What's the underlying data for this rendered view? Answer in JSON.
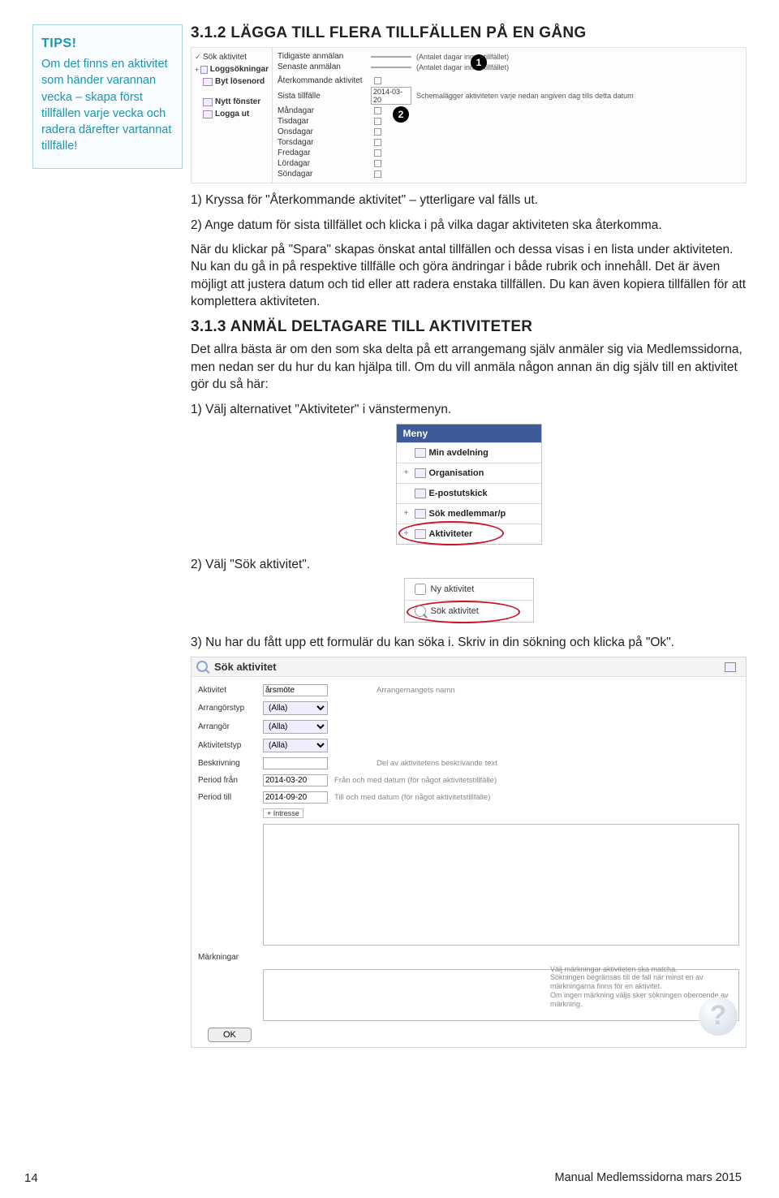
{
  "tip": {
    "title": "TIPS!",
    "text": "Om det finns en aktivitet som händer varannan vecka – skapa först tillfällen varje vecka och radera därefter vartannat tillfälle!"
  },
  "sect312": {
    "heading": "3.1.2 LÄGGA TILL FLERA TILLFÄLLEN PÅ EN GÅNG",
    "step1": "1) Kryssa för \"Återkommande aktivitet\" – ytterligare val fälls ut.",
    "step2": "2) Ange datum för sista tillfället och klicka i på vilka dagar aktiviteten ska återkomma.",
    "para": "När du klickar på \"Spara\" skapas önskat antal tillfällen och dessa visas i en lista under aktiviteten. Nu kan du gå in på respektive tillfälle och göra ändringar i både rubrik och innehåll. Det är även möjligt att justera datum och tid eller att radera enstaka tillfällen. Du kan även kopiera tillfällen för att komplettera aktiviteten."
  },
  "ss1": {
    "left": {
      "sok": "Sök aktivitet",
      "logg": "Loggsökningar",
      "byt": "Byt lösenord",
      "nytt": "Nytt fönster",
      "logga": "Logga ut"
    },
    "right": {
      "tidig": "Tidigaste anmälan",
      "senast": "Senaste anmälan",
      "aterk": "Återkommande aktivitet",
      "sista": "Sista tillfälle",
      "man": "Måndagar",
      "tis": "Tisdagar",
      "ons": "Onsdagar",
      "tor": "Torsdagar",
      "fre": "Fredagar",
      "lor": "Lördagar",
      "son": "Söndagar",
      "sistaVal": "2014-03-20",
      "note1": "(Antalet dagar innan tillfället)",
      "note2": "(Antalet dagar innan tillfället)",
      "note3": "Schemalägger aktiviteten varje nedan angiven dag tills detta datum"
    },
    "badge1": "1",
    "badge2": "2"
  },
  "sect313": {
    "heading": "3.1.3 ANMÄL DELTAGARE TILL AKTIVITETER",
    "intro": "Det allra bästa är om den som ska delta på ett arrangemang själv anmäler sig via Medlemssidorna, men nedan ser du hur du kan hjälpa till. Om du vill anmäla någon annan än dig själv till en aktivitet gör du så här:",
    "s1": "1) Välj alternativet \"Aktiviteter\" i vänstermenyn.",
    "s2": "2) Välj \"Sök aktivitet\".",
    "s3": "3) Nu har du fått upp ett formulär du kan söka i. Skriv in din sökning och klicka på \"Ok\"."
  },
  "menu": {
    "hdr": "Meny",
    "i1": "Min avdelning",
    "i2": "Organisation",
    "i3": "E-postutskick",
    "i4": "Sök medlemmar/p",
    "i5": "Aktiviteter"
  },
  "submenu": {
    "i1": "Ny aktivitet",
    "i2": "Sök aktivitet"
  },
  "form": {
    "title": "Sök aktivitet",
    "aktivitet_l": "Aktivitet",
    "aktivitet_v": "årsmöte",
    "aktivitet_h": "Arrangemangets namn",
    "arrtyp_l": "Arrangörstyp",
    "arrtyp_v": "(Alla)",
    "arr_l": "Arrangör",
    "arr_v": "(Alla)",
    "atyp_l": "Aktivitetstyp",
    "atyp_v": "(Alla)",
    "besk_l": "Beskrivning",
    "besk_h": "Del av aktivitetens beskrivande text",
    "pfran_l": "Period från",
    "pfran_v": "2014-03-20",
    "pfran_h": "Från och med datum (för något aktivitetstillfälle)",
    "ptill_l": "Period till",
    "ptill_v": "2014-09-20",
    "ptill_h": "Till och med datum (för något aktivitetstillfälle)",
    "intresse": "Intresse",
    "mark_l": "Märkningar",
    "mark_note": "Välj märkningar aktiviteten ska matcha.\nSökningen begränsas till de fall när minst en av märkningarna finns för en aktivitet.\nOm ingen märkning väljs sker sökningen oberoende av märkning.",
    "ok": "OK"
  },
  "footer": {
    "page": "14",
    "caption": "Manual Medlemssidorna mars 2015"
  }
}
